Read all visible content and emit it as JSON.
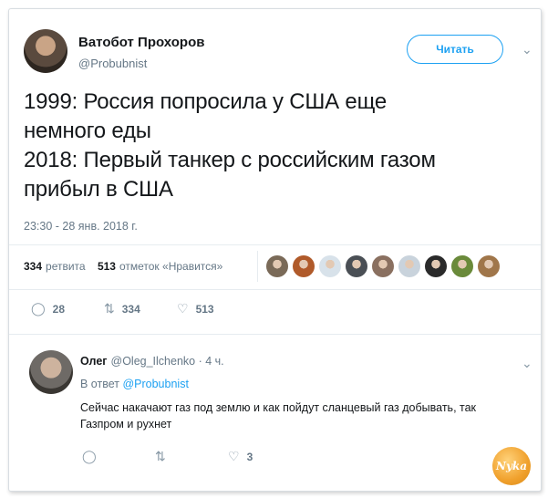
{
  "tweet": {
    "author_name": "Ватобот Прохоров",
    "author_handle": "@Probubnist",
    "follow_label": "Читать",
    "text": "1999: Россия попросила у США еще\nнемного еды\n2018: Первый танкер с российским газом\nприбыл в США",
    "timestamp": "23:30 - 28 янв. 2018 г.",
    "retweets_count": "334",
    "retweets_label": "ретвита",
    "likes_count": "513",
    "likes_label": "отметок «Нравится»",
    "actions": {
      "replies": "28",
      "retweets": "334",
      "likes": "513"
    }
  },
  "likers": [
    "#7a6a58",
    "#b05a2a",
    "#d8e2ea",
    "#4a4f55",
    "#8a7060",
    "#c9d3dc",
    "#2a2a2a",
    "#6a8a3a",
    "#a0764a"
  ],
  "reply": {
    "author_name": "Олег",
    "author_handle": "@Oleg_Ilchenko",
    "time": "· 4 ч.",
    "reply_to_prefix": "В ответ",
    "reply_to_handle": "@Probubnist",
    "text": "Сейчас накачают газ под землю и как пойдут сланцевый газ добывать, так Газпром и рухнет",
    "actions": {
      "likes": "3"
    }
  },
  "watermark": "Nyka",
  "colors": {
    "accent": "#1da1f2",
    "muted": "#657786",
    "text": "#14171a"
  }
}
